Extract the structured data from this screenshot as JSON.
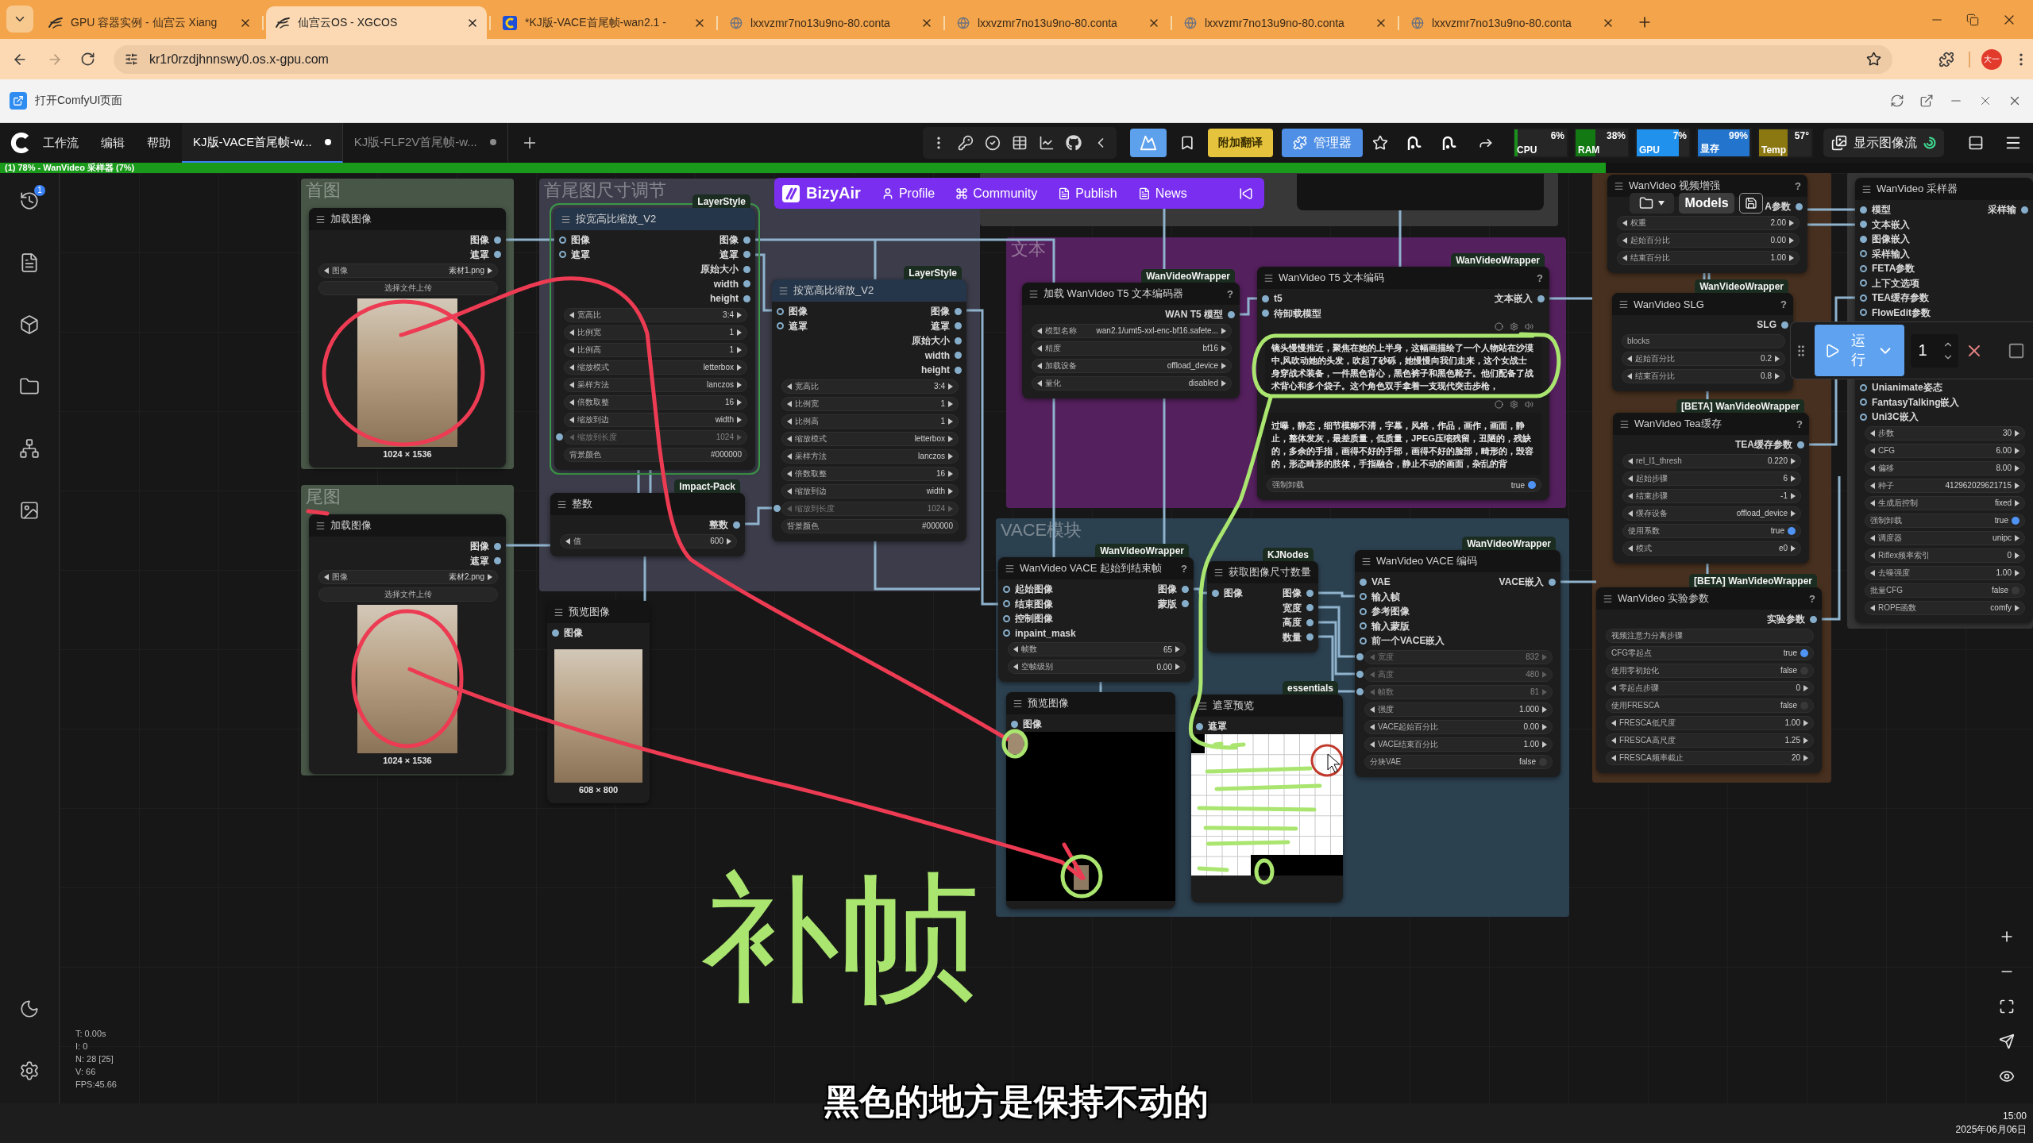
{
  "browser": {
    "tabs": [
      {
        "title": "GPU 容器实例 - 仙宫云 Xiang",
        "kind": "xgc",
        "selected": false
      },
      {
        "title": "仙宫云OS - XGCOS",
        "kind": "xgc",
        "selected": true
      },
      {
        "title": "*KJ版-VACE首尾帧-wan2.1 -",
        "kind": "comfy",
        "selected": false
      },
      {
        "title": "lxxvzmr7no13u9no-80.conta",
        "kind": "globe",
        "selected": false
      },
      {
        "title": "lxxvzmr7no13u9no-80.conta",
        "kind": "globe",
        "selected": false
      },
      {
        "title": "lxxvzmr7no13u9no-80.conta",
        "kind": "globe",
        "selected": false
      },
      {
        "title": "lxxvzmr7no13u9no-80.conta",
        "kind": "globe",
        "selected": false
      }
    ],
    "url": "kr1r0rzdjhnnswy0.os.x-gpu.com",
    "avatar": "大一"
  },
  "app_bar": {
    "link": "打开ComfyUI页面"
  },
  "comfy": {
    "menu": [
      "工作流",
      "编辑",
      "帮助"
    ],
    "workflow_tabs": [
      {
        "title": "KJ版-VACE首尾帧-w...",
        "selected": true,
        "unsaved": true
      },
      {
        "title": "KJ版-FLF2V首尾帧-w...",
        "selected": false,
        "unsaved": true
      }
    ],
    "translate_button": "附加翻译",
    "manager_button": "管理器",
    "monitors": [
      {
        "label": "CPU",
        "reading": "6%",
        "level": 0.06,
        "color": "#1b8f1b"
      },
      {
        "label": "RAM",
        "reading": "38%",
        "level": 0.38,
        "color": "#137a13"
      },
      {
        "label": "GPU",
        "reading": "7%",
        "level": 0.8,
        "color": "#2191ee"
      },
      {
        "label": "显存",
        "reading": "99%",
        "level": 0.99,
        "color": "#2374cc"
      },
      {
        "label": "Temp",
        "reading": "57°",
        "level": 0.55,
        "color": "#8c7810"
      }
    ],
    "image_feed_button": "显示图像流",
    "progress": {
      "text": "(1) 78% - WanVideo 采样器 (7%)",
      "level": 0.79
    }
  },
  "sidebar": {
    "badge": "1"
  },
  "canvas": {
    "groups": [
      {
        "title": "首图",
        "color": "#475647"
      },
      {
        "title": "尾图",
        "color": "#475647"
      },
      {
        "title": "首尾图尺寸调节",
        "color": "#3c3c4a"
      },
      {
        "title": "文本",
        "color": "#55205e"
      },
      {
        "title": "VACE模块",
        "color": "#2c4150"
      },
      {
        "color": "#47301f"
      },
      {
        "color": "#353535"
      },
      {
        "color": "#383838"
      }
    ],
    "nodes": [
      {
        "title": "加载图像",
        "color": "#141414",
        "selected": false,
        "outputs": [
          {
            "label": "图像",
            "connected": true
          },
          {
            "label": "遮罩",
            "connected": true
          }
        ],
        "widgets": [
          {
            "kind": "stepper",
            "label": "图像",
            "value": "素材1.png"
          }
        ],
        "upload": "选择文件上传",
        "preview": {
          "kind": "photo",
          "caption": "1024 × 1536"
        }
      },
      {
        "title": "加载图像",
        "color": "#141414",
        "selected": false,
        "outputs": [
          {
            "label": "图像",
            "connected": true
          },
          {
            "label": "遮罩",
            "connected": true
          }
        ],
        "widgets": [
          {
            "kind": "stepper",
            "label": "图像",
            "value": "素材2.png"
          }
        ],
        "upload": "选择文件上传",
        "preview": {
          "kind": "photo",
          "caption": "1024 × 1536"
        }
      },
      {
        "title": "按宽高比缩放_V2",
        "badge": "LayerStyle",
        "color": "#26364a",
        "selected": true,
        "inputs": [
          {
            "label": "图像",
            "connected": false
          },
          {
            "label": "遮罩",
            "connected": false
          }
        ],
        "outputs": [
          {
            "label": "图像",
            "connected": true
          },
          {
            "label": "遮罩",
            "connected": true
          },
          {
            "label": "原始大小",
            "connected": true
          },
          {
            "label": "width",
            "connected": true
          },
          {
            "label": "height",
            "connected": true
          }
        ],
        "widgets": [
          {
            "kind": "stepper",
            "label": "宽高比",
            "value": "3:4"
          },
          {
            "kind": "stepper",
            "label": "比例宽",
            "value": "1"
          },
          {
            "kind": "stepper",
            "label": "比例高",
            "value": "1"
          },
          {
            "kind": "stepper",
            "label": "缩放模式",
            "value": "letterbox"
          },
          {
            "kind": "stepper",
            "label": "采样方法",
            "value": "lanczos"
          },
          {
            "kind": "stepper",
            "label": "倍数取整",
            "value": "16"
          },
          {
            "kind": "stepper",
            "label": "缩放到边",
            "value": "width"
          },
          {
            "kind": "linked",
            "label": "缩放到长度",
            "value": "1024"
          },
          {
            "kind": "text",
            "label": "背景颜色",
            "value": "#000000"
          }
        ]
      },
      {
        "title": "按宽高比缩放_V2",
        "badge": "LayerStyle",
        "color": "#26364a",
        "selected": false,
        "inputs": [
          {
            "label": "图像",
            "connected": false
          },
          {
            "label": "遮罩",
            "connected": false
          }
        ],
        "outputs": [
          {
            "label": "图像",
            "connected": true
          },
          {
            "label": "遮罩",
            "connected": true
          },
          {
            "label": "原始大小",
            "connected": true
          },
          {
            "label": "width",
            "connected": true
          },
          {
            "label": "height",
            "connected": true
          }
        ],
        "widgets": [
          {
            "kind": "stepper",
            "label": "宽高比",
            "value": "3:4"
          },
          {
            "kind": "stepper",
            "label": "比例宽",
            "value": "1"
          },
          {
            "kind": "stepper",
            "label": "比例高",
            "value": "1"
          },
          {
            "kind": "stepper",
            "label": "缩放模式",
            "value": "letterbox"
          },
          {
            "kind": "stepper",
            "label": "采样方法",
            "value": "lanczos"
          },
          {
            "kind": "stepper",
            "label": "倍数取整",
            "value": "16"
          },
          {
            "kind": "stepper",
            "label": "缩放到边",
            "value": "width"
          },
          {
            "kind": "linked",
            "label": "缩放到长度",
            "value": "1024"
          },
          {
            "kind": "text",
            "label": "背景颜色",
            "value": "#000000"
          }
        ]
      },
      {
        "title": "整数",
        "badge": "Impact-Pack",
        "color": "#141414",
        "selected": false,
        "outputs": [
          {
            "label": "整数",
            "connected": true
          }
        ],
        "widgets": [
          {
            "kind": "stepper",
            "label": "值",
            "value": "600"
          }
        ]
      },
      {
        "title": "预览图像",
        "color": "#141414",
        "selected": false,
        "inputs": [
          {
            "label": "图像",
            "connected": true
          }
        ],
        "preview": {
          "kind": "photo",
          "caption": "608 × 800"
        }
      },
      {
        "title": "加载 WanVideo T5 文本编码器",
        "badge": "WanVideoWrapper",
        "help": "?",
        "color": "#141414",
        "selected": false,
        "outputs": [
          {
            "label": "WAN T5 模型",
            "connected": true
          }
        ],
        "widgets": [
          {
            "kind": "stepper",
            "label": "模型名称",
            "value": "wan2.1/umt5-xxl-enc-bf16.safete..."
          },
          {
            "kind": "stepper",
            "label": "精度",
            "value": "bf16"
          },
          {
            "kind": "stepper",
            "label": "加载设备",
            "value": "offload_device"
          },
          {
            "kind": "stepper",
            "label": "量化",
            "value": "disabled"
          }
        ]
      },
      {
        "title": "WanVideo T5 文本编码",
        "badge": "WanVideoWrapper",
        "help": "?",
        "color": "#141414",
        "selected": false,
        "inputs": [
          {
            "label": "t5",
            "connected": true
          },
          {
            "label": "待卸载模型",
            "connected": true
          }
        ],
        "outputs": [
          {
            "label": "文本嵌入",
            "connected": true
          }
        ],
        "prompts": [
          {
            "text": "镜头慢慢推近，聚焦在她的上半身，这幅画描绘了一个人物站在沙漠中,风吹动她的头发，吹起了砂砾，她慢慢向我们走来，这个女战士身穿战术装备，一件黑色背心，黑色裤子和黑色靴子。他们配备了战术背心和多个袋子。这个角色双手拿着一支现代突击步枪，"
          },
          {
            "text": "过曝，静态，细节模糊不清，字幕，风格，作品，画作，画面，静止，整体发灰，最差质量，低质量，JPEG压缩残留，丑陋的，残缺的，多余的手指，画得不好的手部，画得不好的脸部，畸形的，毁容的，形态畸形的肢体，手指融合，静止不动的画面，杂乱的背"
          }
        ],
        "widgets": [
          {
            "kind": "toggle",
            "label": "强制卸载",
            "value": "true",
            "on": true
          }
        ]
      },
      {
        "title": "WanVideo VACE 起始到结束帧",
        "badge": "WanVideoWrapper",
        "help": "?",
        "color": "#141414",
        "selected": false,
        "inputs": [
          {
            "label": "起始图像",
            "connected": false
          },
          {
            "label": "结束图像",
            "connected": false
          },
          {
            "label": "控制图像",
            "connected": false
          },
          {
            "label": "inpaint_mask",
            "connected": false
          }
        ],
        "outputs": [
          {
            "label": "图像",
            "connected": true
          },
          {
            "label": "蒙版",
            "connected": true
          }
        ],
        "widgets": [
          {
            "kind": "stepper",
            "label": "帧数",
            "value": "65"
          },
          {
            "kind": "stepper",
            "label": "空帧级别",
            "value": "0.00"
          }
        ]
      },
      {
        "title": "获取图像尺寸数量",
        "badge": "KJNodes",
        "color": "#141414",
        "selected": false,
        "inputs": [
          {
            "label": "图像",
            "connected": true
          }
        ],
        "outputs": [
          {
            "label": "图像",
            "connected": true
          },
          {
            "label": "宽度",
            "connected": true
          },
          {
            "label": "高度",
            "connected": true
          },
          {
            "label": "数量",
            "connected": true
          }
        ]
      },
      {
        "title": "WanVideo VACE 编码",
        "badge": "WanVideoWrapper",
        "color": "#141414",
        "selected": false,
        "inputs": [
          {
            "label": "VAE",
            "connected": true
          },
          {
            "label": "输入帧",
            "connected": false
          },
          {
            "label": "参考图像",
            "connected": false
          },
          {
            "label": "输入蒙版",
            "connected": false
          },
          {
            "label": "前一个VACE嵌入",
            "connected": false
          }
        ],
        "outputs": [
          {
            "label": "VACE嵌入",
            "connected": true
          }
        ],
        "widgets": [
          {
            "kind": "linked",
            "label": "宽度",
            "value": "832"
          },
          {
            "kind": "linked",
            "label": "高度",
            "value": "480"
          },
          {
            "kind": "linked",
            "label": "帧数",
            "value": "81"
          },
          {
            "kind": "stepper",
            "label": "强度",
            "value": "1.000"
          },
          {
            "kind": "stepper",
            "label": "VACE起始百分比",
            "value": "0.00"
          },
          {
            "kind": "stepper",
            "label": "VACE结束百分比",
            "value": "1.00"
          },
          {
            "kind": "toggle",
            "label": "分块VAE",
            "value": "false",
            "on": false
          }
        ]
      },
      {
        "title": "预览图像",
        "color": "#141414",
        "selected": false,
        "inputs": [
          {
            "label": "图像",
            "connected": true
          }
        ],
        "preview": {
          "kind": "frames"
        }
      },
      {
        "title": "遮罩预览",
        "badge": "essentials",
        "color": "#141414",
        "selected": false,
        "inputs": [
          {
            "label": "遮罩",
            "connected": true
          }
        ],
        "preview": {
          "kind": "mask"
        }
      },
      {
        "title": "WanVideo 视频增强",
        "help": "?",
        "color": "#141414",
        "selected": false,
        "outputs": [
          {
            "label": "A参数",
            "connected": true
          }
        ],
        "widgets": [
          {
            "kind": "stepper",
            "label": "权重",
            "value": "2.00"
          },
          {
            "kind": "stepper",
            "label": "起始百分比",
            "value": "0.00"
          },
          {
            "kind": "stepper",
            "label": "结束百分比",
            "value": "1.00"
          }
        ]
      },
      {
        "title": "WanVideo SLG",
        "badge": "WanVideoWrapper",
        "help": "?",
        "color": "#141414",
        "selected": false,
        "outputs": [
          {
            "label": "SLG",
            "connected": true
          }
        ],
        "widgets": [
          {
            "kind": "text",
            "label": "blocks"
          },
          {
            "kind": "stepper",
            "label": "起始百分比",
            "value": "0.2"
          },
          {
            "kind": "stepper",
            "label": "结束百分比",
            "value": "0.8"
          }
        ]
      },
      {
        "title": "WanVideo Tea缓存",
        "badge": "[BETA] WanVideoWrapper",
        "help": "?",
        "color": "#141414",
        "selected": false,
        "outputs": [
          {
            "label": "TEA缓存参数",
            "connected": true
          }
        ],
        "widgets": [
          {
            "kind": "stepper",
            "label": "rel_l1_thresh",
            "value": "0.220"
          },
          {
            "kind": "stepper",
            "label": "起始步骤",
            "value": "6"
          },
          {
            "kind": "stepper",
            "label": "结束步骤",
            "value": "-1"
          },
          {
            "kind": "stepper",
            "label": "缓存设备",
            "value": "offload_device"
          },
          {
            "kind": "toggle",
            "label": "使用系数",
            "value": "true",
            "on": true
          },
          {
            "kind": "stepper",
            "label": "模式",
            "value": "e0"
          }
        ]
      },
      {
        "title": "WanVideo 实验参数",
        "badge": "[BETA] WanVideoWrapper",
        "help": "?",
        "color": "#141414",
        "selected": false,
        "outputs": [
          {
            "label": "实验参数",
            "connected": true
          }
        ],
        "widgets": [
          {
            "kind": "text",
            "label": "视频注意力分离步骤"
          },
          {
            "kind": "toggle",
            "label": "CFG零起点",
            "value": "true",
            "on": true
          },
          {
            "kind": "toggle",
            "label": "使用零初始化",
            "value": "false",
            "on": false
          },
          {
            "kind": "stepper",
            "label": "零起点步骤",
            "value": "0"
          },
          {
            "kind": "toggle",
            "label": "使用FRESCA",
            "value": "false",
            "on": false
          },
          {
            "kind": "stepper",
            "label": "FRESCA低尺度",
            "value": "1.00"
          },
          {
            "kind": "stepper",
            "label": "FRESCA高尺度",
            "value": "1.25"
          },
          {
            "kind": "stepper",
            "label": "FRESCA频率截止",
            "value": "20"
          }
        ]
      },
      {
        "title": "WanVideo 采样器",
        "color": "#141414",
        "selected": false,
        "inputs": [
          {
            "label": "模型",
            "connected": true
          },
          {
            "label": "文本嵌入",
            "connected": true
          },
          {
            "label": "图像嵌入",
            "connected": true
          },
          {
            "label": "采样输入",
            "connected": false
          },
          {
            "label": "FETA参数",
            "connected": false
          },
          {
            "label": "上下文选项",
            "connected": false
          },
          {
            "label": "TEA缓存参数",
            "connected": false
          },
          {
            "label": "FlowEdit参数",
            "connected": false
          },
          {
            "label": "Unianimate姿态",
            "connected": false
          },
          {
            "label": "FantasyTalking嵌入",
            "connected": false
          },
          {
            "label": "Uni3C嵌入",
            "connected": false
          }
        ],
        "outputs": [
          {
            "label": "采样输",
            "connected": true
          }
        ],
        "widgets": [
          {
            "kind": "stepper",
            "label": "步数",
            "value": "30"
          },
          {
            "kind": "stepper",
            "label": "CFG",
            "value": "6.00"
          },
          {
            "kind": "stepper",
            "label": "偏移",
            "value": "8.00"
          },
          {
            "kind": "stepper",
            "label": "种子",
            "value": "412962029621715"
          },
          {
            "kind": "stepper",
            "label": "生成后控制",
            "value": "fixed"
          },
          {
            "kind": "toggle",
            "label": "强制卸载",
            "value": "true",
            "on": true
          },
          {
            "kind": "stepper",
            "label": "调度器",
            "value": "unipc"
          },
          {
            "kind": "stepper",
            "label": "Riflex频率索引",
            "value": "0"
          },
          {
            "kind": "stepper",
            "label": "去噪强度",
            "value": "1.00"
          },
          {
            "kind": "toggle",
            "label": "批量CFG",
            "value": "false",
            "on": false
          },
          {
            "kind": "stepper",
            "label": "ROPE函数",
            "value": "comfy"
          }
        ]
      }
    ],
    "bizyair": {
      "brand": "BizyAir",
      "links": [
        {
          "label": "Profile",
          "kind": "user"
        },
        {
          "label": "Community",
          "kind": "command"
        },
        {
          "label": "Publish",
          "kind": "document"
        },
        {
          "label": "News",
          "kind": "document"
        }
      ]
    },
    "models_toolbar": {
      "label": "Models"
    },
    "run_toolbar": {
      "label": "运行",
      "count": "1"
    },
    "stats": [
      "T: 0.00s",
      "I: 0",
      "N: 28 [25]",
      "V: 66",
      "FPS:45.66"
    ],
    "handwritten_note": "补帧"
  },
  "subtitle": "黑色的地方是保持不动的",
  "taskbar": {
    "time": "15:00",
    "date": "2025年06月06日"
  }
}
